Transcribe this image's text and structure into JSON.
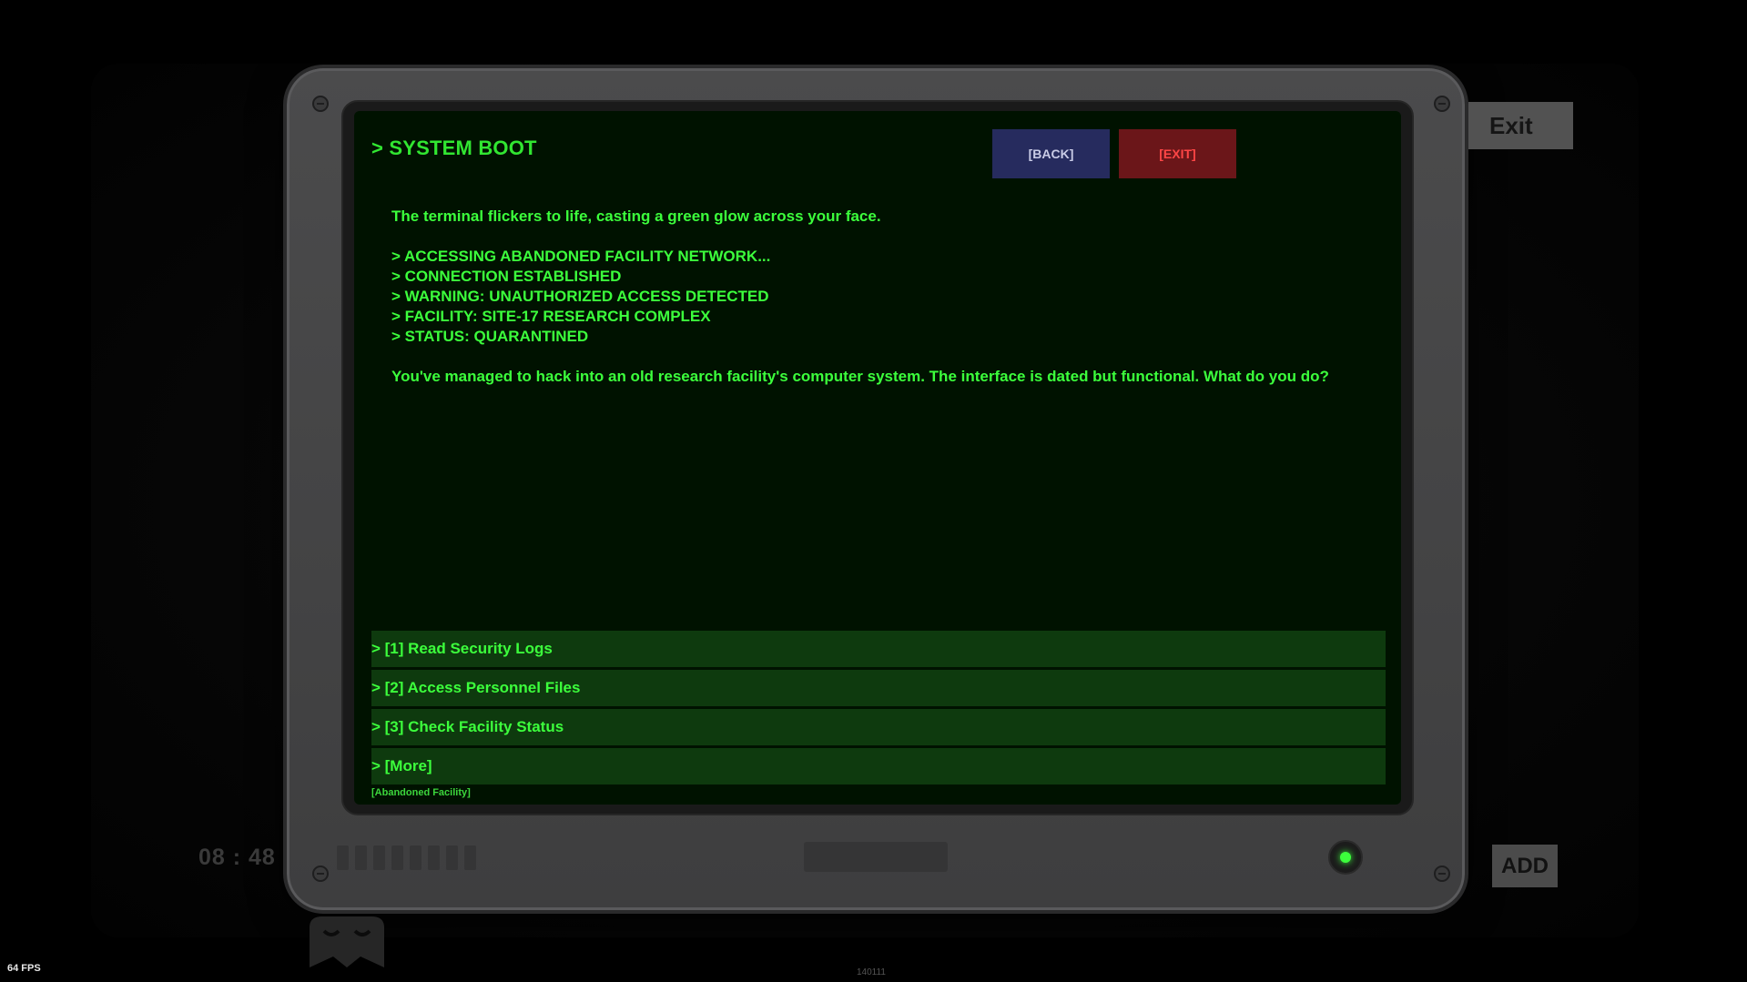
{
  "terminal": {
    "title": "> SYSTEM BOOT",
    "back_label": "[BACK]",
    "exit_label": "[EXIT]",
    "intro": "The terminal flickers to life, casting a green glow across your face.",
    "log_lines": [
      "> ACCESSING ABANDONED FACILITY NETWORK...",
      "> CONNECTION ESTABLISHED",
      "> WARNING: UNAUTHORIZED ACCESS DETECTED",
      "> FACILITY: SITE-17 RESEARCH COMPLEX",
      "> STATUS: QUARANTINED"
    ],
    "prompt": "You've managed to hack into an old research facility's computer system. The interface is dated but functional. What do you do?",
    "choices": [
      "> [1] Read Security Logs",
      "> [2] Access Personnel Files",
      "> [3] Check Facility Status",
      "> [More]"
    ],
    "location": "[Abandoned Facility]"
  },
  "hud": {
    "exit_label": "Exit",
    "add_label": "ADD",
    "clock": "08 : 48",
    "fps": "64 FPS",
    "build": "140111"
  },
  "colors": {
    "terminal_green": "#3cff3c",
    "screen_bg": "#001200",
    "choice_bg": "#0e3a0e",
    "back_button": "#262b5e",
    "exit_button": "#6b1619",
    "exit_text": "#ff4646",
    "power_led": "#3cff3c"
  },
  "icons": {
    "screws": "screw-icon",
    "power": "power-led-icon",
    "mascot": "hooded-figure-icon"
  }
}
